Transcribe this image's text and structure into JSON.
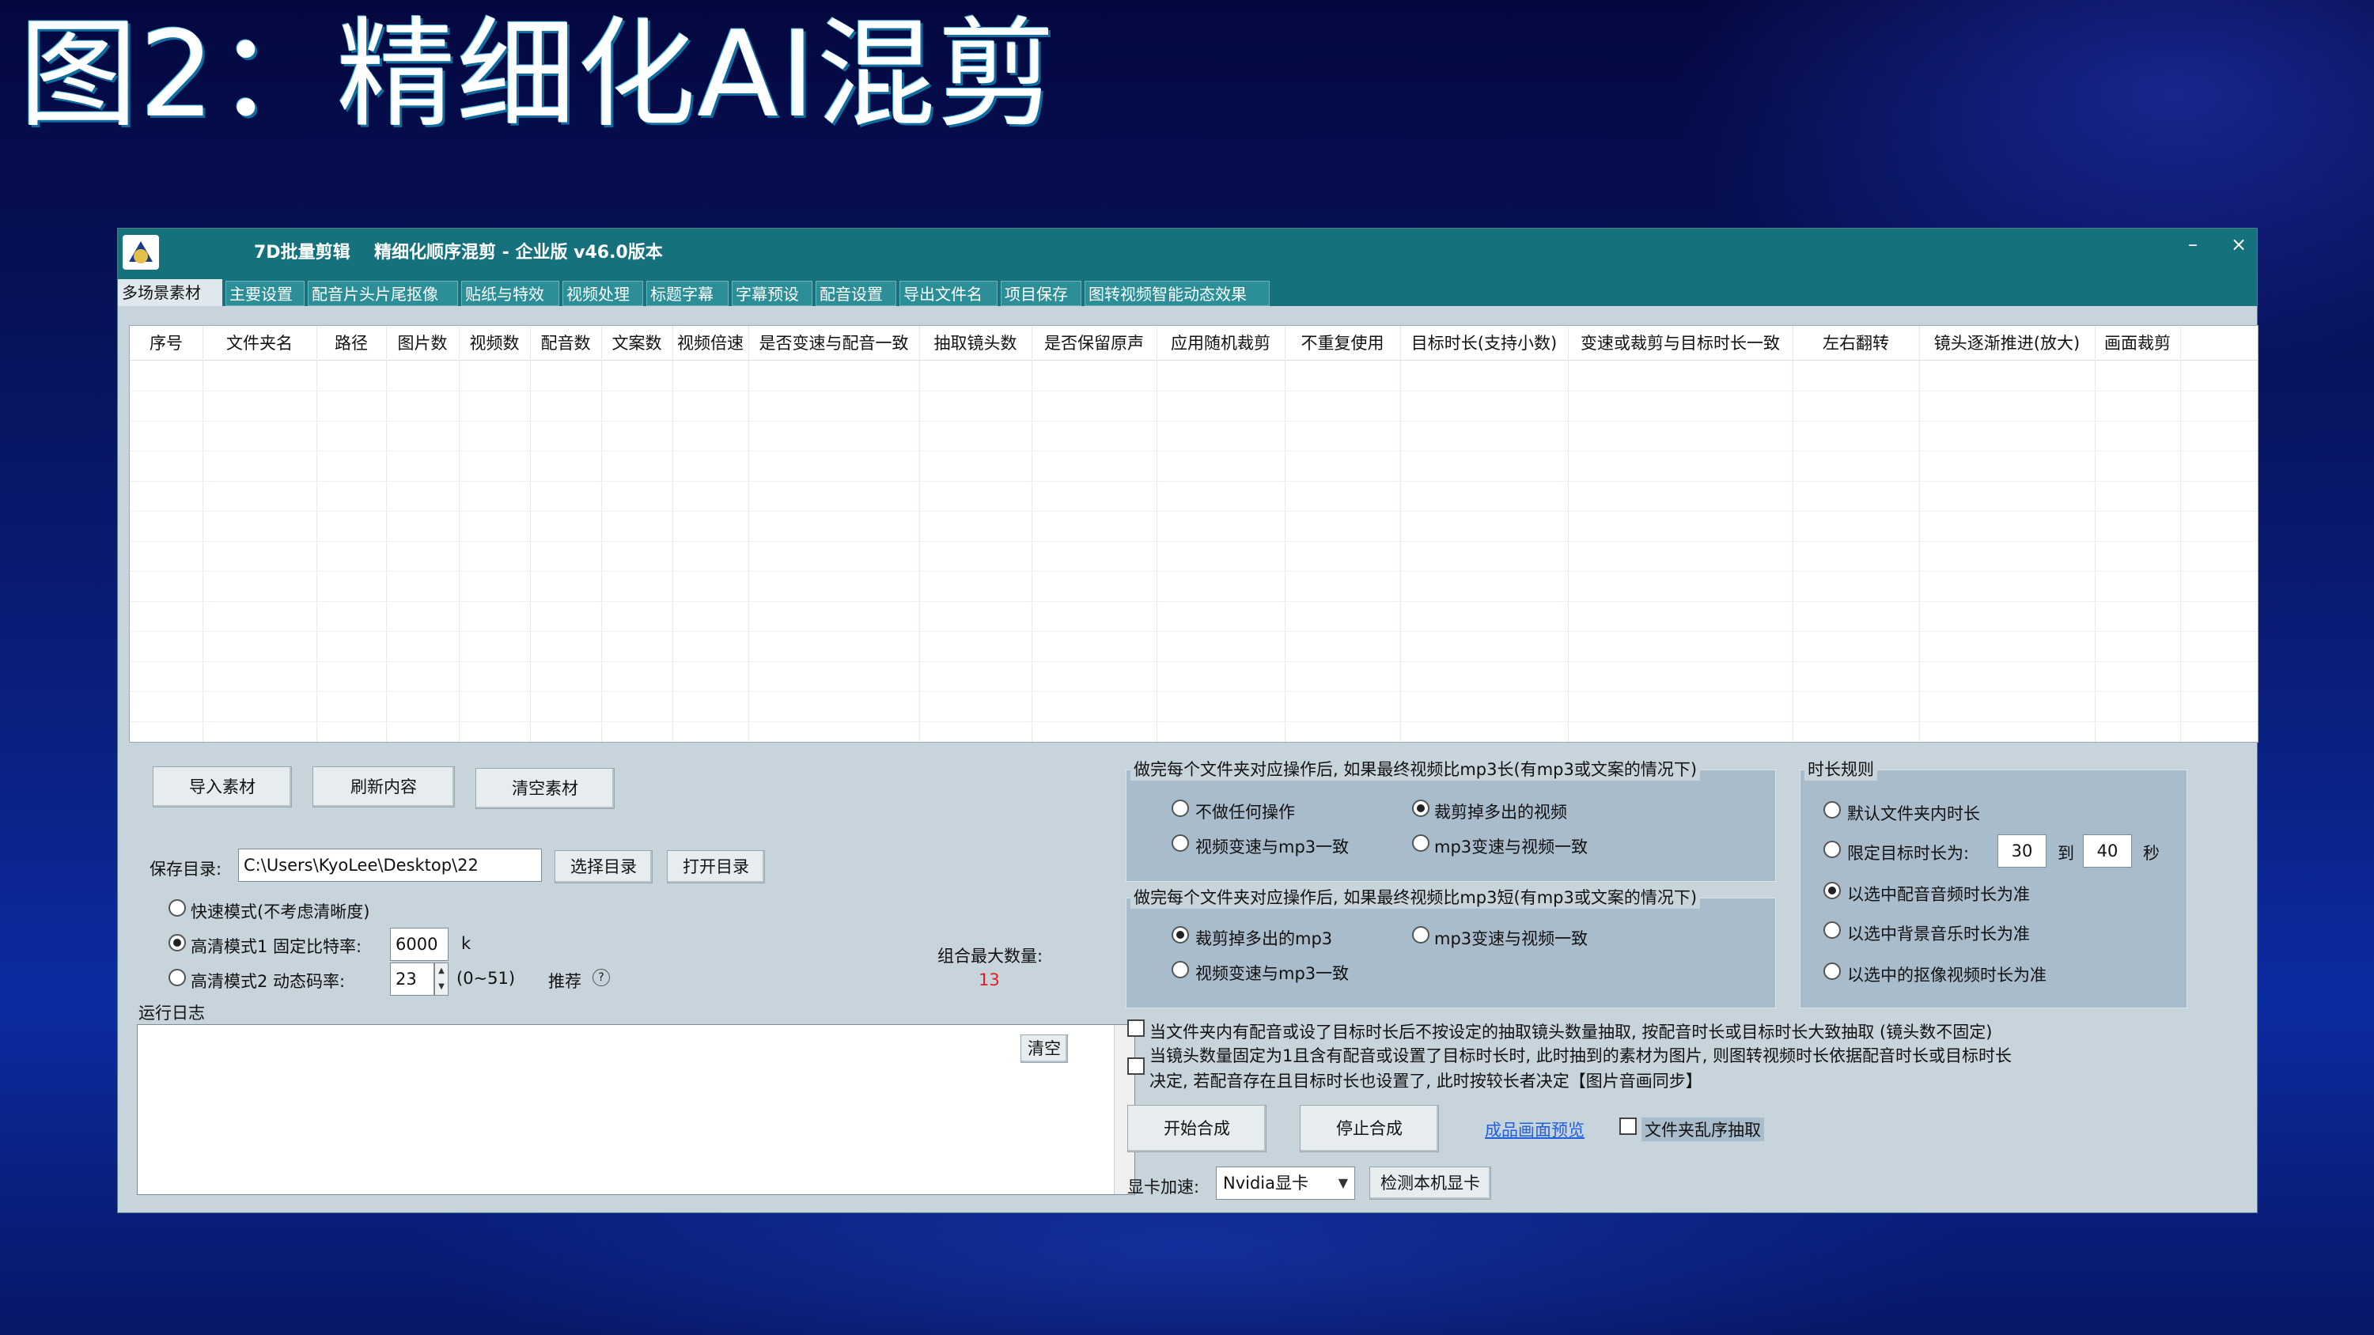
{
  "slide": {
    "title": "图2：精细化AI混剪"
  },
  "window": {
    "app_name": "7D批量剪辑",
    "subtitle": "精细化顺序混剪 - 企业版  v46.0版本",
    "minimize": "–",
    "close": "×"
  },
  "tabs": [
    {
      "label": "多场景素材",
      "active": true
    },
    {
      "label": "主要设置"
    },
    {
      "label": "配音片头片尾抠像"
    },
    {
      "label": "贴纸与特效"
    },
    {
      "label": "视频处理"
    },
    {
      "label": "标题字幕"
    },
    {
      "label": "字幕预设"
    },
    {
      "label": "配音设置"
    },
    {
      "label": "导出文件名"
    },
    {
      "label": "项目保存"
    },
    {
      "label": "图转视频智能动态效果"
    }
  ],
  "table": {
    "columns": [
      "序号",
      "文件夹名",
      "路径",
      "图片数",
      "视频数",
      "配音数",
      "文案数",
      "视频倍速",
      "是否变速与配音一致",
      "抽取镜头数",
      "是否保留原声",
      "应用随机裁剪",
      "不重复使用",
      "目标时长(支持小数)",
      "变速或裁剪与目标时长一致",
      "左右翻转",
      "镜头逐渐推进(放大)",
      "画面裁剪"
    ],
    "rows": []
  },
  "actions": {
    "import": "导入素材",
    "refresh": "刷新内容",
    "clear": "清空素材"
  },
  "save": {
    "label": "保存目录:",
    "path": "C:\\Users\\KyoLee\\Desktop\\22",
    "choose": "选择目录",
    "open": "打开目录"
  },
  "modes": {
    "fast": "快速模式(不考虑清晰度)",
    "hd1": "高清模式1  固定比特率:",
    "hd1_value": "6000",
    "hd1_unit": "k",
    "hd2": "高清模式2  动态码率:",
    "hd2_value": "23",
    "hd2_range": "(0~51)",
    "hd2_recommend": "推荐",
    "help_icon": "?",
    "selected": "hd1"
  },
  "combo": {
    "label": "组合最大数量:",
    "value": "13"
  },
  "log": {
    "label": "运行日志",
    "clear": "清空"
  },
  "group_longer": {
    "title": "做完每个文件夹对应操作后, 如果最终视频比mp3长(有mp3或文案的情况下)",
    "opt_none": "不做任何操作",
    "opt_cut": "裁剪掉多出的视频",
    "opt_speed": "视频变速与mp3一致",
    "opt_mp3": "mp3变速与视频一致",
    "selected": "opt_cut"
  },
  "group_shorter": {
    "title": "做完每个文件夹对应操作后, 如果最终视频比mp3短(有mp3或文案的情况下)",
    "opt_cut": "裁剪掉多出的mp3",
    "opt_mp3": "mp3变速与视频一致",
    "opt_speed": "视频变速与mp3一致",
    "selected": "opt_cut"
  },
  "duration": {
    "title": "时长规则",
    "default": "默认文件夹内时长",
    "limit": "限定目标时长为:",
    "from": "30",
    "to_label": "到",
    "to": "40",
    "unit": "秒",
    "by_voice": "以选中配音音频时长为准",
    "by_bgm": "以选中背景音乐时长为准",
    "by_matte": "以选中的抠像视频时长为准",
    "selected": "by_voice"
  },
  "checks": {
    "c1": "当文件夹内有配音或设了目标时长后不按设定的抽取镜头数量抽取, 按配音时长或目标时长大致抽取 (镜头数不固定)",
    "c2_line1": "当镜头数量固定为1且含有配音或设置了目标时长时, 此时抽到的素材为图片, 则图转视频时长依据配音时长或目标时长",
    "c2_line2": "决定, 若配音存在且目标时长也设置了, 此时按较长者决定【图片音画同步】"
  },
  "run": {
    "start": "开始合成",
    "stop": "停止合成",
    "preview": "成品画面预览",
    "shuffle": "文件夹乱序抽取"
  },
  "gpu": {
    "label": "显卡加速:",
    "value": "Nvidia显卡",
    "detect": "检测本机显卡"
  },
  "colors": {
    "titlebar": "#15717b",
    "panel": "#c8d4dc",
    "group": "#a9bccb",
    "count": "#e02020",
    "link": "#1f5fe0"
  }
}
